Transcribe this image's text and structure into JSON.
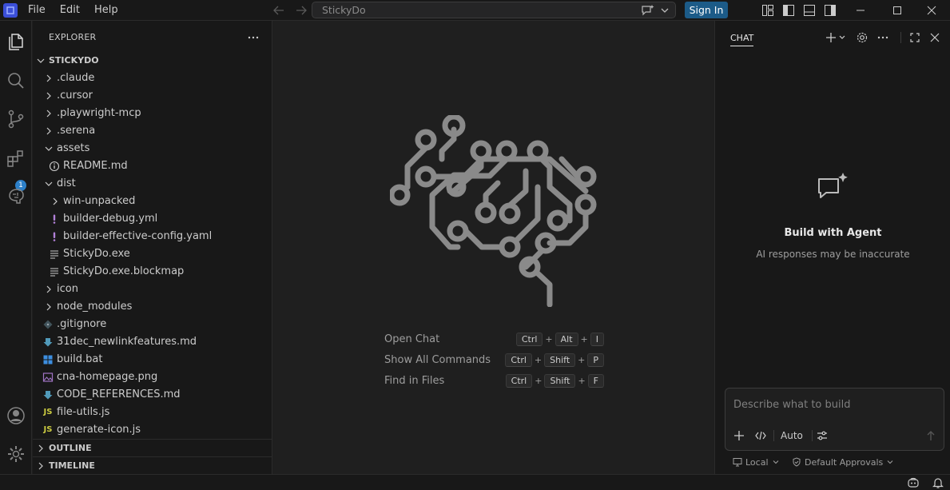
{
  "menu": [
    "File",
    "Edit",
    "Help"
  ],
  "command_center": {
    "text": "StickyDo"
  },
  "signin_label": "Sign In",
  "activity_bar": {
    "items": [
      "explorer-icon",
      "search-icon",
      "source-control-icon",
      "extensions-icon",
      "brain-icon"
    ],
    "extensions_badge": "1",
    "bottom": [
      "account-icon",
      "gear-icon"
    ]
  },
  "explorer": {
    "title": "EXPLORER",
    "root": "STICKYDO",
    "items": [
      {
        "label": ".claude",
        "type": "folder",
        "expanded": false,
        "depth": 1
      },
      {
        "label": ".cursor",
        "type": "folder",
        "expanded": false,
        "depth": 1
      },
      {
        "label": ".playwright-mcp",
        "type": "folder",
        "expanded": false,
        "depth": 1
      },
      {
        "label": ".serena",
        "type": "folder",
        "expanded": false,
        "depth": 1
      },
      {
        "label": "assets",
        "type": "folder",
        "expanded": true,
        "depth": 1
      },
      {
        "label": "README.md",
        "type": "info",
        "depth": 2
      },
      {
        "label": "dist",
        "type": "folder",
        "expanded": true,
        "depth": 1
      },
      {
        "label": "win-unpacked",
        "type": "folder",
        "expanded": false,
        "depth": 2
      },
      {
        "label": "builder-debug.yml",
        "type": "yaml",
        "depth": 2
      },
      {
        "label": "builder-effective-config.yaml",
        "type": "yaml",
        "depth": 2
      },
      {
        "label": "StickyDo.exe",
        "type": "lines",
        "depth": 2
      },
      {
        "label": "StickyDo.exe.blockmap",
        "type": "lines",
        "depth": 2
      },
      {
        "label": "icon",
        "type": "folder",
        "expanded": false,
        "depth": 1
      },
      {
        "label": "node_modules",
        "type": "folder",
        "expanded": false,
        "depth": 1
      },
      {
        "label": ".gitignore",
        "type": "git",
        "depth": 1
      },
      {
        "label": "31dec_newlinkfeatures.md",
        "type": "md",
        "depth": 1
      },
      {
        "label": "build.bat",
        "type": "windows",
        "depth": 1
      },
      {
        "label": "cna-homepage.png",
        "type": "image",
        "depth": 1
      },
      {
        "label": "CODE_REFERENCES.md",
        "type": "md",
        "depth": 1
      },
      {
        "label": "file-utils.js",
        "type": "js",
        "depth": 1
      },
      {
        "label": "generate-icon.js",
        "type": "js",
        "depth": 1
      }
    ],
    "sections": [
      "OUTLINE",
      "TIMELINE"
    ]
  },
  "editor": {
    "watermark_icon": "brain-circuit-icon",
    "shortcuts": [
      {
        "label": "Open Chat",
        "keys": [
          "Ctrl",
          "Alt",
          "I"
        ]
      },
      {
        "label": "Show All Commands",
        "keys": [
          "Ctrl",
          "Shift",
          "P"
        ]
      },
      {
        "label": "Find in Files",
        "keys": [
          "Ctrl",
          "Shift",
          "F"
        ]
      }
    ]
  },
  "chat": {
    "tab": "CHAT",
    "title": "Build with Agent",
    "subtitle": "AI responses may be inaccurate",
    "input_placeholder": "Describe what to build",
    "mode_label": "Auto",
    "footer_local": "Local",
    "footer_approvals": "Default Approvals"
  },
  "colors": {
    "accent": "#1c5b88",
    "badge": "#2d80c9",
    "yaml": "#b180d7",
    "markdown": "#519aba",
    "javascript": "#cbcb41"
  }
}
